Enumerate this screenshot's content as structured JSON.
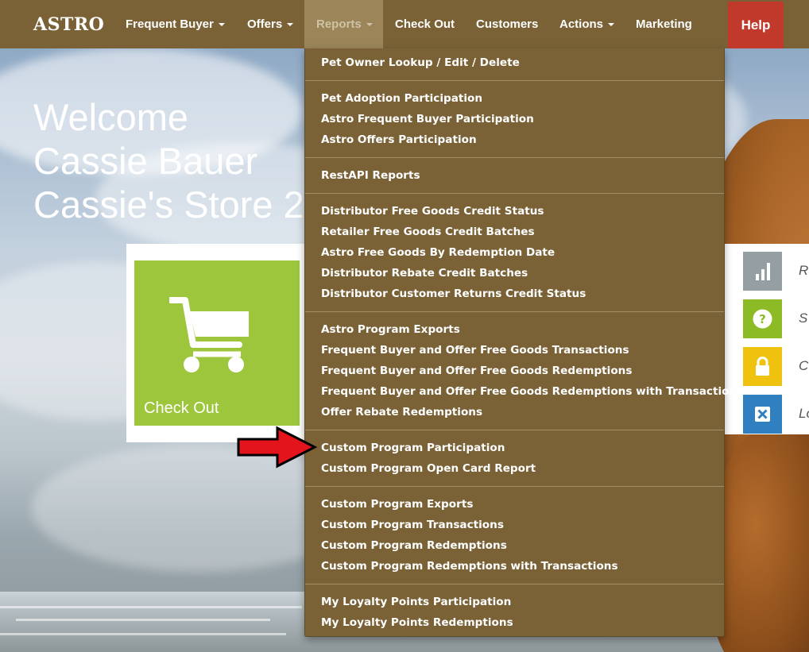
{
  "nav": {
    "brand": "ASTRO",
    "items": [
      {
        "label": "Frequent Buyer",
        "has_caret": true
      },
      {
        "label": "Offers",
        "has_caret": true
      },
      {
        "label": "Reports",
        "has_caret": true,
        "active": true
      },
      {
        "label": "Check Out",
        "has_caret": false
      },
      {
        "label": "Customers",
        "has_caret": false
      },
      {
        "label": "Actions",
        "has_caret": true
      },
      {
        "label": "Marketing",
        "has_caret": false
      }
    ],
    "help_label": "Help"
  },
  "welcome": {
    "line1": "Welcome",
    "line2": "Cassie Bauer",
    "line3": "Cassie's Store 2"
  },
  "checkout_tile": {
    "label": "Check Out",
    "icon": "shopping-cart-icon",
    "color": "#9dc63d"
  },
  "side_tiles": [
    {
      "icon": "bar-chart-icon",
      "color": "#959ea3",
      "text": "R"
    },
    {
      "icon": "question-circle-icon",
      "color": "#8dbb25",
      "text": "S"
    },
    {
      "icon": "lock-icon",
      "color": "#efc20f",
      "text": "C"
    },
    {
      "icon": "close-box-icon",
      "color": "#2f7fc1",
      "text": "Lo"
    }
  ],
  "reports_menu": {
    "groups": [
      [
        "Pet Owner Lookup / Edit / Delete"
      ],
      [
        "Pet Adoption Participation",
        "Astro Frequent Buyer Participation",
        "Astro Offers Participation"
      ],
      [
        "RestAPI Reports"
      ],
      [
        "Distributor Free Goods Credit Status",
        "Retailer Free Goods Credit Batches",
        "Astro Free Goods By Redemption Date",
        "Distributor Rebate Credit Batches",
        "Distributor Customer Returns Credit Status"
      ],
      [
        "Astro Program Exports",
        "Frequent Buyer and Offer Free Goods Transactions",
        "Frequent Buyer and Offer Free Goods Redemptions",
        "Frequent Buyer and Offer Free Goods Redemptions with Transactions",
        "Offer Rebate Redemptions"
      ],
      [
        "Custom Program Participation",
        "Custom Program Open Card Report"
      ],
      [
        "Custom Program Exports",
        "Custom Program Transactions",
        "Custom Program Redemptions",
        "Custom Program Redemptions with Transactions"
      ],
      [
        "My Loyalty Points Participation",
        "My Loyalty Points Redemptions"
      ]
    ]
  },
  "colors": {
    "navbar": "#7a6236",
    "help": "#c0392b",
    "arrow": "#e3141b"
  }
}
